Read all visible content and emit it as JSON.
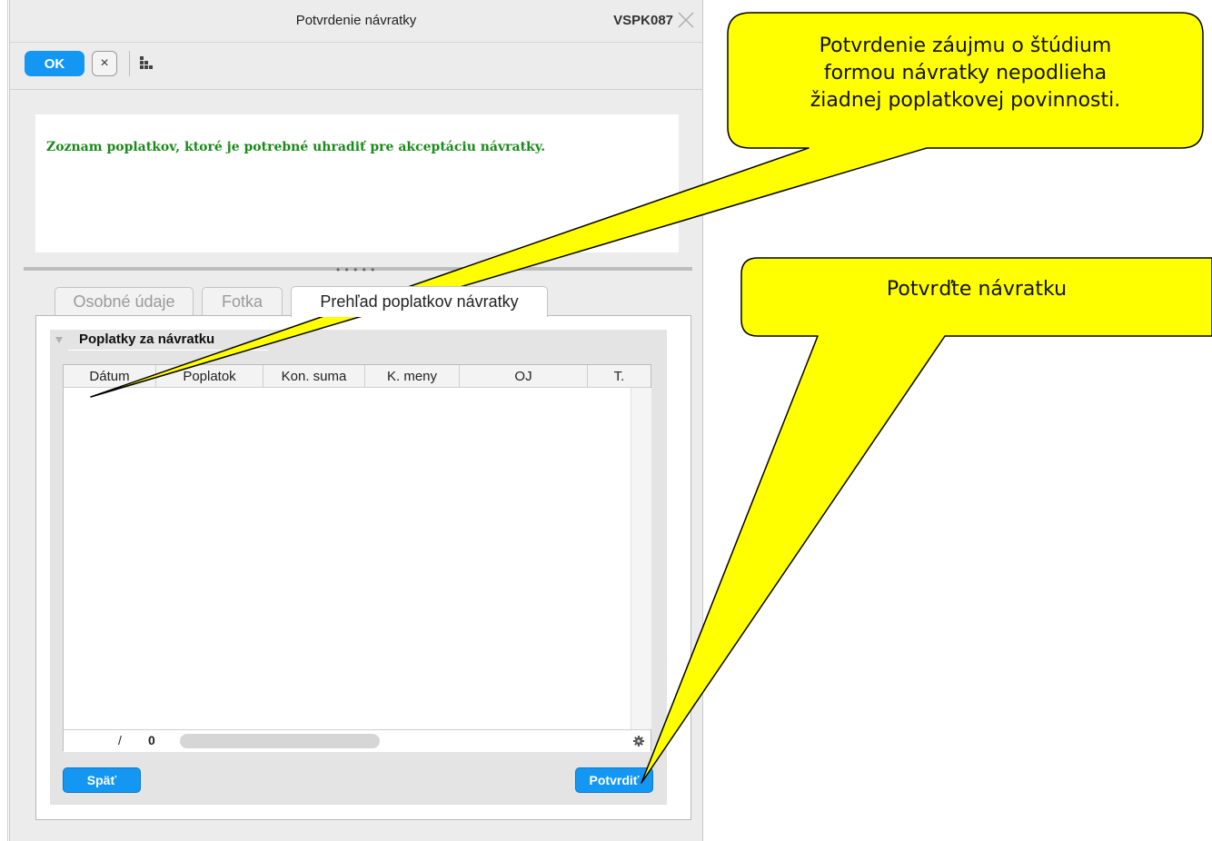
{
  "window": {
    "title": "Potvrdenie návratky",
    "code": "VSPK087"
  },
  "toolbar": {
    "ok_label": "OK",
    "cancel_symbol": "×"
  },
  "info": {
    "text": "Zoznam poplatkov, ktoré je potrebné uhradiť pre akceptáciu návratky."
  },
  "splitter_grip": "• • • • •",
  "tabs": [
    {
      "label": "Osobné údaje",
      "active": false
    },
    {
      "label": "Fotka",
      "active": false
    },
    {
      "label": "Prehľad poplatkov návratky",
      "active": true
    }
  ],
  "group": {
    "title": "Poplatky za návratku"
  },
  "grid": {
    "columns": [
      "Dátum",
      "Poplatok",
      "Kon. suma",
      "K. meny",
      "OJ",
      "T."
    ],
    "rows": [],
    "pager_slash": "/",
    "pager_count": "0"
  },
  "buttons": {
    "back": "Späť",
    "confirm": "Potvrdiť"
  },
  "callouts": [
    {
      "text_lines": [
        "Potvrdenie záujmu o štúdium",
        "formou návratky nepodlieha",
        "žiadnej poplatkovej povinnosti."
      ]
    },
    {
      "text_lines": [
        "Potvrďte návratku"
      ]
    }
  ],
  "colors": {
    "accent": "#1497f3",
    "info_text": "#1a8a1a",
    "callout_fill": "#ffff00"
  }
}
